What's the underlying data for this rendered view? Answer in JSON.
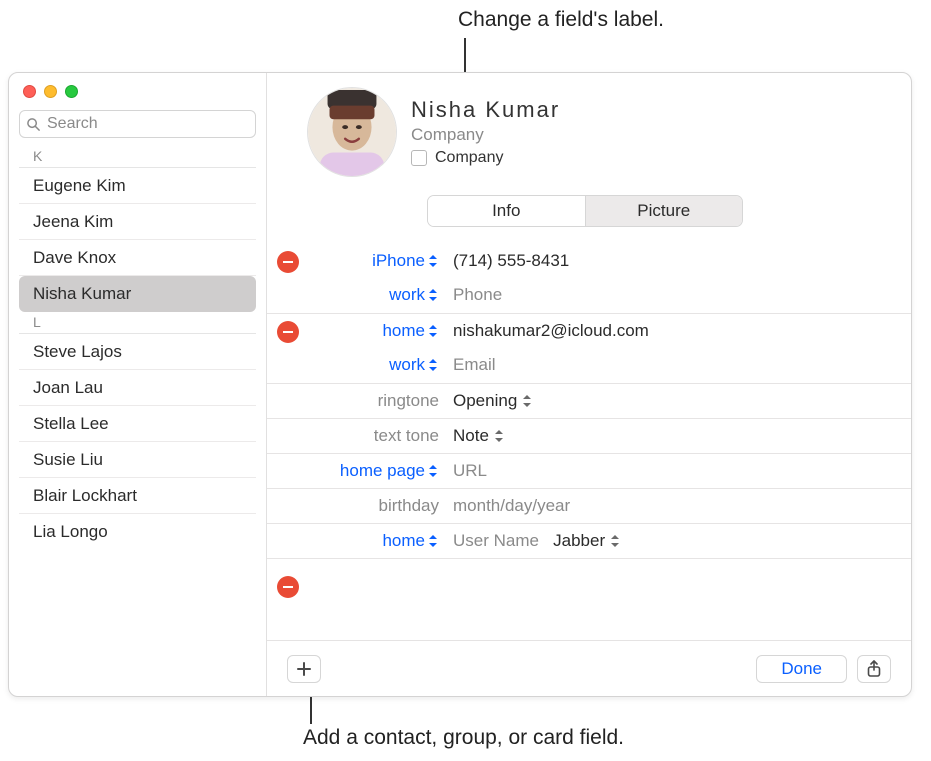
{
  "callouts": {
    "top": "Change a field's label.",
    "bottom": "Add a contact, group, or card field."
  },
  "search": {
    "placeholder": "Search"
  },
  "sections": {
    "k": {
      "header": "K",
      "items": [
        "Eugene Kim",
        "Jeena Kim",
        "Dave Knox",
        "Nisha Kumar"
      ]
    },
    "l": {
      "header": "L",
      "items": [
        "Steve Lajos",
        "Joan Lau",
        "Stella Lee",
        "Susie Liu",
        "Blair Lockhart",
        "Lia Longo"
      ]
    }
  },
  "selected_index": 3,
  "card": {
    "name": "Nisha  Kumar",
    "company_placeholder": "Company",
    "company_checkbox_label": "Company"
  },
  "tabs": {
    "info": "Info",
    "picture": "Picture"
  },
  "fields": {
    "phone1": {
      "label": "iPhone",
      "value": "(714) 555-8431"
    },
    "phone2": {
      "label": "work",
      "placeholder": "Phone"
    },
    "email1": {
      "label": "home",
      "value": "nishakumar2@icloud.com"
    },
    "email2": {
      "label": "work",
      "placeholder": "Email"
    },
    "ringtone": {
      "label": "ringtone",
      "value": "Opening"
    },
    "texttone": {
      "label": "text tone",
      "value": "Note"
    },
    "homepage": {
      "label": "home page",
      "placeholder": "URL"
    },
    "birthday": {
      "label": "birthday",
      "placeholder": "month/day/year"
    },
    "im": {
      "label": "home",
      "placeholder": "User Name",
      "service": "Jabber"
    }
  },
  "buttons": {
    "done": "Done"
  }
}
